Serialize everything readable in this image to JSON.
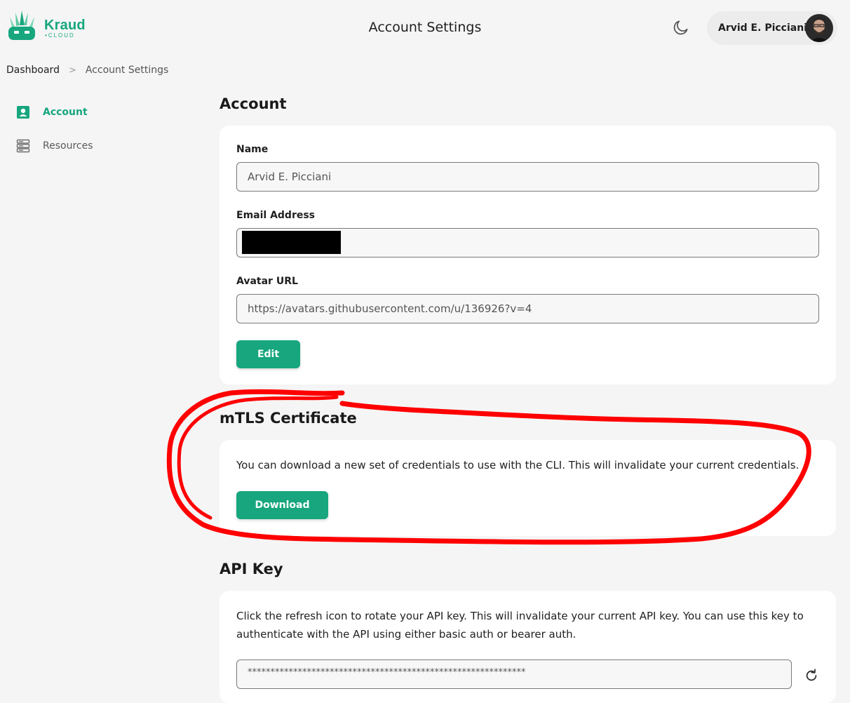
{
  "brand": {
    "name": "Kraud",
    "sub": "CLOUD"
  },
  "header": {
    "title": "Account Settings",
    "user_name": "Arvid E. Picciani"
  },
  "breadcrumb": {
    "home": "Dashboard",
    "separator": ">",
    "current": "Account Settings"
  },
  "sidebar": {
    "items": [
      {
        "label": "Account",
        "icon": "account-icon",
        "active": true
      },
      {
        "label": "Resources",
        "icon": "server-icon",
        "active": false
      }
    ]
  },
  "account": {
    "title": "Account",
    "name_label": "Name",
    "name_value": "Arvid E. Picciani",
    "email_label": "Email Address",
    "email_value": "",
    "avatar_label": "Avatar URL",
    "avatar_value": "https://avatars.githubusercontent.com/u/136926?v=4",
    "edit_label": "Edit"
  },
  "mtls": {
    "title": "mTLS Certificate",
    "description": "You can download a new set of credentials to use with the CLI. This will invalidate your current credentials.",
    "download_label": "Download"
  },
  "apikey": {
    "title": "API Key",
    "description": "Click the refresh icon to rotate your API key. This will invalidate your current API key. You can use this key to authenticate with the API using either basic auth or bearer auth.",
    "value": "*************************************************************"
  },
  "colors": {
    "accent": "#17a67e",
    "annotation": "#ff0000",
    "background": "#f5f5f5"
  }
}
